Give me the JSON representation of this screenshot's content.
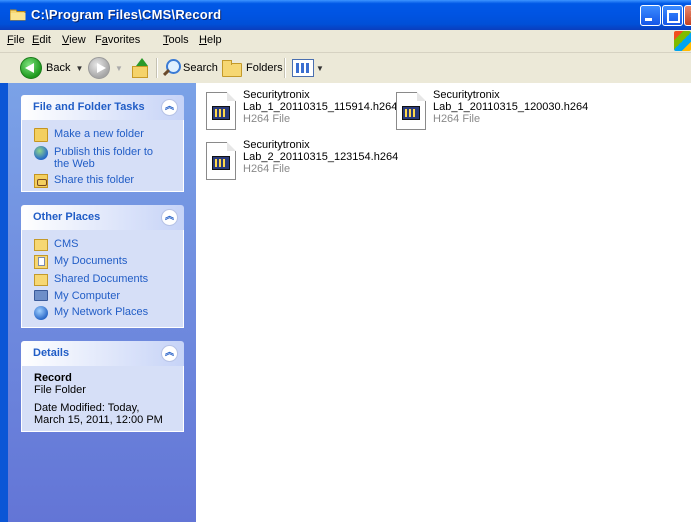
{
  "window": {
    "title": "C:\\Program Files\\CMS\\Record"
  },
  "menu": {
    "items": [
      {
        "u": "F",
        "rest": "ile"
      },
      {
        "u": "E",
        "rest": "dit"
      },
      {
        "u": "V",
        "rest": "iew"
      },
      {
        "pre": "F",
        "u": "a",
        "rest": "vorites"
      },
      {
        "u": "T",
        "rest": "ools"
      },
      {
        "u": "H",
        "rest": "elp"
      }
    ]
  },
  "toolbar": {
    "back": "Back",
    "search": "Search",
    "folders": "Folders"
  },
  "tasks": {
    "title": "File and Folder Tasks",
    "items": [
      "Make a new folder",
      "Publish this folder to the Web",
      "Share this folder"
    ]
  },
  "places": {
    "title": "Other Places",
    "items": [
      "CMS",
      "My Documents",
      "Shared Documents",
      "My Computer",
      "My Network Places"
    ]
  },
  "details": {
    "title": "Details",
    "name": "Record",
    "type": "File Folder",
    "modified": "Date Modified: Today, March 15, 2011, 12:00 PM"
  },
  "files": [
    {
      "company": "Securitytronix",
      "name": "Lab_1_20110315_115914.h264",
      "type": "H264 File"
    },
    {
      "company": "Securitytronix",
      "name": "Lab_1_20110315_120030.h264",
      "type": "H264 File"
    },
    {
      "company": "Securitytronix",
      "name": "Lab_2_20110315_123154.h264",
      "type": "H264 File"
    }
  ]
}
